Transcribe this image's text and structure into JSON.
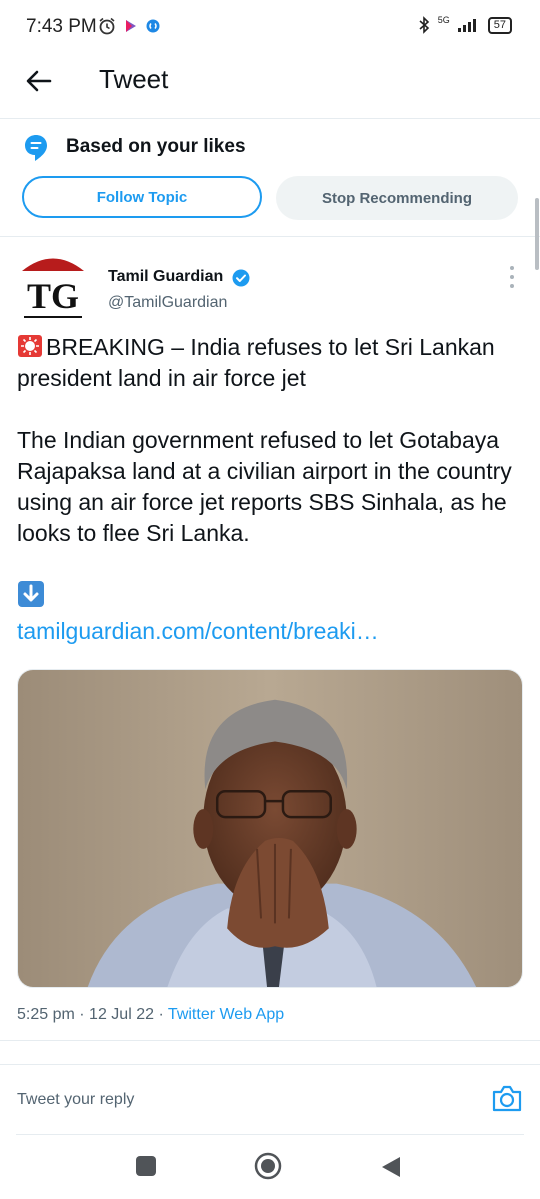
{
  "status_bar": {
    "time": "7:43 PM",
    "network": "5G",
    "battery": "57"
  },
  "header": {
    "title": "Tweet"
  },
  "topic": {
    "label": "Based on your likes",
    "follow_button": "Follow Topic",
    "stop_button": "Stop Recommending"
  },
  "tweet": {
    "author_logo_text": "TG",
    "author_name": "Tamil Guardian",
    "author_handle": "@TamilGuardian",
    "headline": "BREAKING – India refuses to let Sri Lankan president land in air force jet",
    "body": "The Indian government refused to let Gotabaya Rajapaksa land at a civilian airport in the country using an air force jet reports SBS Sinhala, as he looks to flee Sri Lanka.",
    "link": "tamilguardian.com/content/breaki…",
    "time": "5:25 pm",
    "date": "12 Jul 22",
    "source": "Twitter Web App"
  },
  "reply": {
    "placeholder": "Tweet your reply"
  },
  "colors": {
    "accent": "#1d9bf0",
    "text": "#0f1419",
    "muted": "#536471"
  }
}
